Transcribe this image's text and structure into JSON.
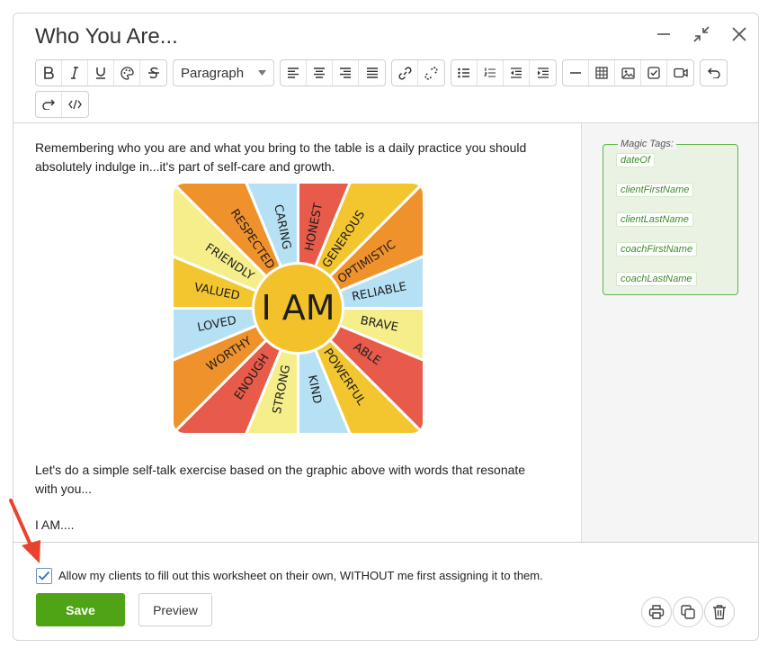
{
  "dialog": {
    "title": "Who You Are...",
    "controls": [
      "minimize-icon",
      "collapse-icon",
      "close-icon"
    ]
  },
  "toolbar": {
    "row1_group1": [
      "bold-icon",
      "italic-icon",
      "underline-icon",
      "color-palette-icon",
      "strikethrough-icon"
    ],
    "block_format": "Paragraph",
    "row1_group2": [
      "align-left-icon",
      "align-center-icon",
      "align-right-icon",
      "align-justify-icon"
    ],
    "row1_group3": [
      "link-icon",
      "unlink-icon"
    ],
    "row1_group4": [
      "bullet-list-icon",
      "numbered-list-icon",
      "outdent-icon",
      "indent-icon"
    ],
    "row1_group5": [
      "horizontal-rule-icon",
      "table-icon",
      "image-icon",
      "checkbox-icon",
      "video-icon"
    ],
    "row1_group6": [
      "undo-icon"
    ],
    "row2_group1": [
      "redo-icon",
      "code-view-icon"
    ]
  },
  "content": {
    "intro": "Remembering who you are and what you bring to the table is a daily practice you should absolutely indulge in...it's part of self-care and growth.",
    "graphic": {
      "center": "I AM",
      "words": [
        "HONEST",
        "GENEROUS",
        "OPTIMISTIC",
        "RELIABLE",
        "BRAVE",
        "ABLE",
        "POWERFUL",
        "KIND",
        "STRONG",
        "ENOUGH",
        "WORTHY",
        "LOVED",
        "VALUED",
        "FRIENDLY",
        "RESPECTED",
        "CARING"
      ],
      "colors": [
        "#e85a4a",
        "#f3c630",
        "#f0922b",
        "#b6e1f4",
        "#f5ee8a",
        "#e85a4a",
        "#f3c630",
        "#b6e1f4",
        "#f5ee8a",
        "#e85a4a",
        "#f0922b",
        "#b6e1f4",
        "#f3c630",
        "#f5ee8a",
        "#f0922b",
        "#b6e1f4"
      ],
      "center_color": "#f3c12a"
    },
    "exercise": "Let's do a simple self-talk exercise based on the graphic above with words that resonate with you...",
    "prompt": "I AM...."
  },
  "magic_tags": {
    "legend": "Magic Tags:",
    "tags": [
      "dateOf",
      "clientFirstName",
      "clientLastName",
      "coachFirstName",
      "coachLastName"
    ]
  },
  "footer": {
    "allow_label": "Allow my clients to fill out this worksheet on their own, WITHOUT me first assigning it to them.",
    "allow_checked": true,
    "save_label": "Save",
    "preview_label": "Preview",
    "actions": [
      "print-icon",
      "copy-icon",
      "delete-icon"
    ]
  },
  "colors": {
    "accent": "#4fa415",
    "tag_border": "#5fb34a",
    "arrow": "#e8432c"
  }
}
